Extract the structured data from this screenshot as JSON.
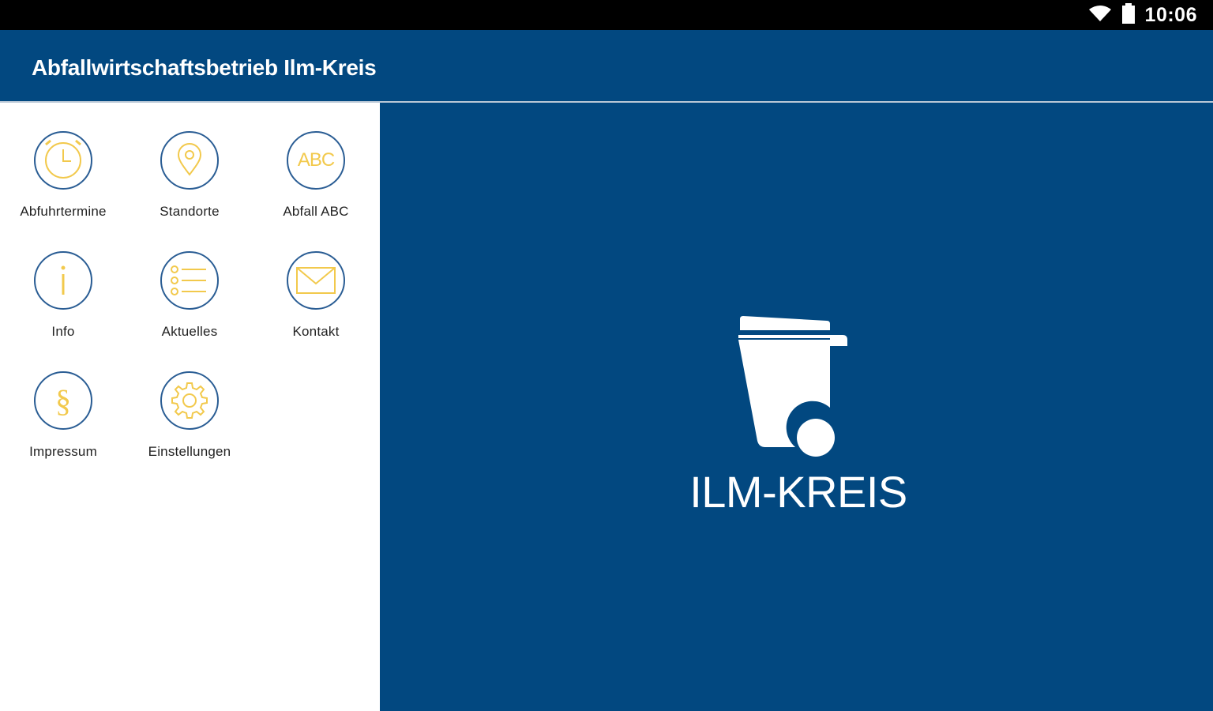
{
  "status": {
    "time": "10:06",
    "icons": [
      "wifi-icon",
      "battery-icon"
    ]
  },
  "appbar": {
    "title": "Abfallwirtschaftsbetrieb Ilm-Kreis"
  },
  "menu": {
    "items": [
      {
        "label": "Abfuhrtermine",
        "icon": "alarm-clock-icon"
      },
      {
        "label": "Standorte",
        "icon": "location-pin-icon"
      },
      {
        "label": "Abfall ABC",
        "icon": "abc-icon",
        "icon_text": "ABC"
      },
      {
        "label": "Info",
        "icon": "info-icon"
      },
      {
        "label": "Aktuelles",
        "icon": "list-icon"
      },
      {
        "label": "Kontakt",
        "icon": "envelope-icon"
      },
      {
        "label": "Impressum",
        "icon": "paragraph-icon",
        "icon_text": "§"
      },
      {
        "label": "Einstellungen",
        "icon": "gear-icon"
      }
    ]
  },
  "hero": {
    "logo_text": "ILM-KREIS",
    "logo_icon": "waste-bin-icon"
  },
  "colors": {
    "brand_blue": "#024880",
    "icon_yellow": "#f2c94c",
    "icon_ring": "#2a5d94"
  }
}
